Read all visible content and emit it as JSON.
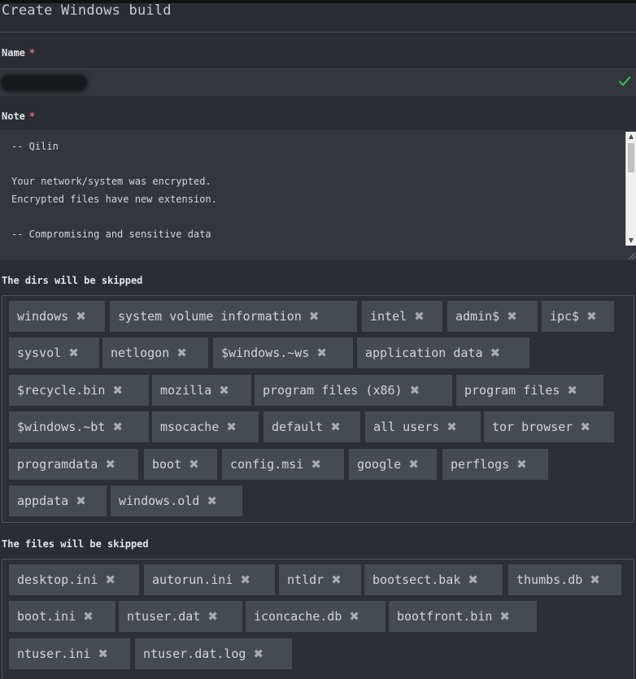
{
  "title": "Create Windows build",
  "name_field": {
    "label": "Name",
    "required_mark": "*",
    "value_redacted": true,
    "valid_icon": "check-icon"
  },
  "note_field": {
    "label": "Note",
    "required_mark": "*",
    "text": "-- Qilin\n\nYour network/system was encrypted.\nEncrypted files have new extension.\n\n-- Compromising and sensitive data"
  },
  "skipped_dirs": {
    "label": "The dirs will be skipped",
    "remove_icon": "x",
    "items": [
      "windows",
      "system volume information",
      "intel",
      "admin$",
      "ipc$",
      "sysvol",
      "netlogon",
      "$windows.~ws",
      "application data",
      "$recycle.bin",
      "mozilla",
      "program files (x86)",
      "program files",
      "$windows.~bt",
      "msocache",
      "default",
      "all users",
      "tor browser",
      "programdata",
      "boot",
      "config.msi",
      "google",
      "perflogs",
      "appdata",
      "windows.old"
    ]
  },
  "skipped_files": {
    "label": "The files will be skipped",
    "remove_icon": "x",
    "items": [
      "desktop.ini",
      "autorun.ini",
      "ntldr",
      "bootsect.bak",
      "thumbs.db",
      "boot.ini",
      "ntuser.dat",
      "iconcache.db",
      "bootfront.bin",
      "ntuser.ini",
      "ntuser.dat.log"
    ]
  },
  "colors": {
    "background": "#2a2d33",
    "tag_background": "#464a51",
    "required": "#e06c75",
    "valid": "#3fb950"
  }
}
